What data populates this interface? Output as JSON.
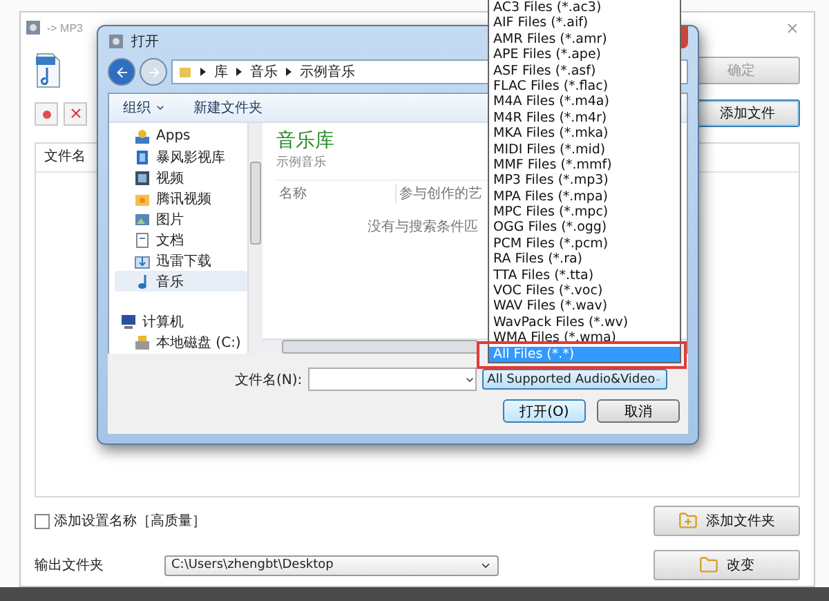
{
  "app": {
    "title": "-> MP3",
    "confirm_button": {
      "label": "确定",
      "disabled": true
    },
    "add_file_button": "添加文件",
    "table": {
      "columns": [
        "文件名"
      ]
    },
    "add_name_checkbox": {
      "label": "添加设置名称［高质量］",
      "checked": false
    },
    "add_folder_button": "添加文件夹",
    "output": {
      "label": "输出文件夹",
      "value": "C:\\Users\\zhengbt\\Desktop"
    },
    "change_button": "改变"
  },
  "dialog": {
    "title": "打开",
    "breadcrumb": [
      "库",
      "音乐",
      "示例音乐"
    ],
    "commands": [
      {
        "label": "组织",
        "has_menu": true
      },
      {
        "label": "新建文件夹",
        "has_menu": false
      }
    ],
    "nav": [
      {
        "label": "Apps",
        "kind": "apps",
        "selected": false
      },
      {
        "label": "暴风影视库",
        "kind": "video",
        "selected": false
      },
      {
        "label": "视频",
        "kind": "film",
        "selected": false
      },
      {
        "label": "腾讯视频",
        "kind": "folder",
        "selected": false
      },
      {
        "label": "图片",
        "kind": "image",
        "selected": false
      },
      {
        "label": "文档",
        "kind": "document",
        "selected": false
      },
      {
        "label": "迅雷下载",
        "kind": "download",
        "selected": false
      },
      {
        "label": "音乐",
        "kind": "music",
        "selected": true
      },
      {
        "label": "计算机",
        "kind": "computer",
        "selected": false
      },
      {
        "label": "本地磁盘 (C:)",
        "kind": "drive",
        "selected": false
      }
    ],
    "library": {
      "title": "音乐库",
      "subtitle": "示例音乐",
      "columns": [
        "名称",
        "参与创作的艺"
      ],
      "empty_message": "没有与搜索条件匹"
    },
    "filename": {
      "label": "文件名(N):"
    },
    "filetype": {
      "value": "All Supported Audio&Video",
      "expanded": true
    },
    "buttons": [
      {
        "label": "打开(O)",
        "default": true
      },
      {
        "label": "取消",
        "default": false
      }
    ]
  },
  "filetype_list": [
    {
      "label": "AC3 Files (*.ac3)",
      "selected": false
    },
    {
      "label": "AIF Files (*.aif)",
      "selected": false
    },
    {
      "label": "AMR Files (*.amr)",
      "selected": false
    },
    {
      "label": "APE Files (*.ape)",
      "selected": false
    },
    {
      "label": "ASF Files (*.asf)",
      "selected": false
    },
    {
      "label": "FLAC Files (*.flac)",
      "selected": false
    },
    {
      "label": "M4A Files (*.m4a)",
      "selected": false
    },
    {
      "label": "M4R Files (*.m4r)",
      "selected": false
    },
    {
      "label": "MKA Files (*.mka)",
      "selected": false
    },
    {
      "label": "MIDI Files (*.mid)",
      "selected": false
    },
    {
      "label": "MMF Files (*.mmf)",
      "selected": false
    },
    {
      "label": "MP3 Files (*.mp3)",
      "selected": false
    },
    {
      "label": "MPA Files (*.mpa)",
      "selected": false
    },
    {
      "label": "MPC Files (*.mpc)",
      "selected": false
    },
    {
      "label": "OGG Files (*.ogg)",
      "selected": false
    },
    {
      "label": "PCM Files (*.pcm)",
      "selected": false
    },
    {
      "label": "RA Files (*.ra)",
      "selected": false
    },
    {
      "label": "TTA Files (*.tta)",
      "selected": false
    },
    {
      "label": "VOC Files (*.voc)",
      "selected": false
    },
    {
      "label": "WAV Files (*.wav)",
      "selected": false
    },
    {
      "label": "WavPack Files (*.wv)",
      "selected": false
    },
    {
      "label": "WMA Files (*.wma)",
      "selected": false
    },
    {
      "label": "All Files (*.*)",
      "selected": true
    }
  ],
  "annotation": {
    "kind": "box"
  }
}
